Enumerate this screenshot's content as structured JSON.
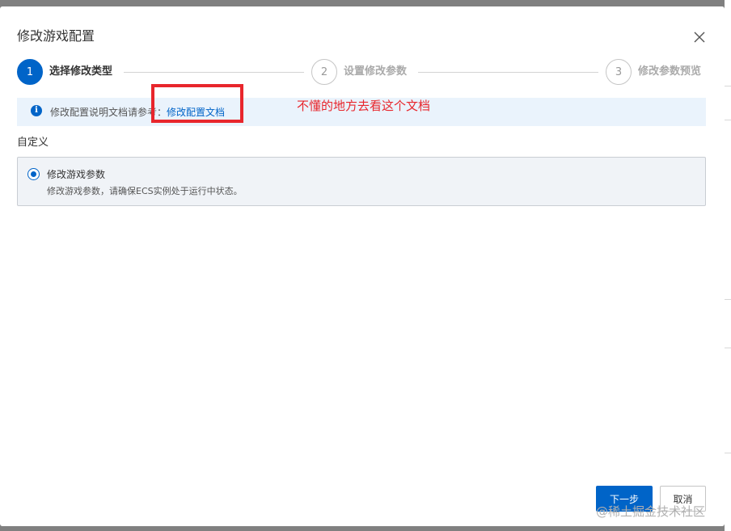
{
  "dialog": {
    "title": "修改游戏配置"
  },
  "steps": [
    {
      "number": "1",
      "label": "选择修改类型",
      "active": true
    },
    {
      "number": "2",
      "label": "设置修改参数",
      "active": false
    },
    {
      "number": "3",
      "label": "修改参数预览",
      "active": false
    }
  ],
  "notice": {
    "text": "修改配置说明文档请参考",
    "separator": "：",
    "link_label": "修改配置文档"
  },
  "annotation": "不懂的地方去看这个文档",
  "section_label": "自定义",
  "option": {
    "title": "修改游戏参数",
    "description": "修改游戏参数，请确保ECS实例处于运行中状态。",
    "selected": true
  },
  "buttons": {
    "next": "下一步",
    "cancel": "取消"
  },
  "watermark": "@稀土掘金技术社区",
  "icons": {
    "close": "close-icon",
    "info": "info-icon",
    "radio": "radio-selected-icon"
  },
  "colors": {
    "primary": "#0064c8",
    "annotation_red": "#e8262c",
    "notice_bg": "#eaf3fc",
    "overlay": "#808080"
  }
}
